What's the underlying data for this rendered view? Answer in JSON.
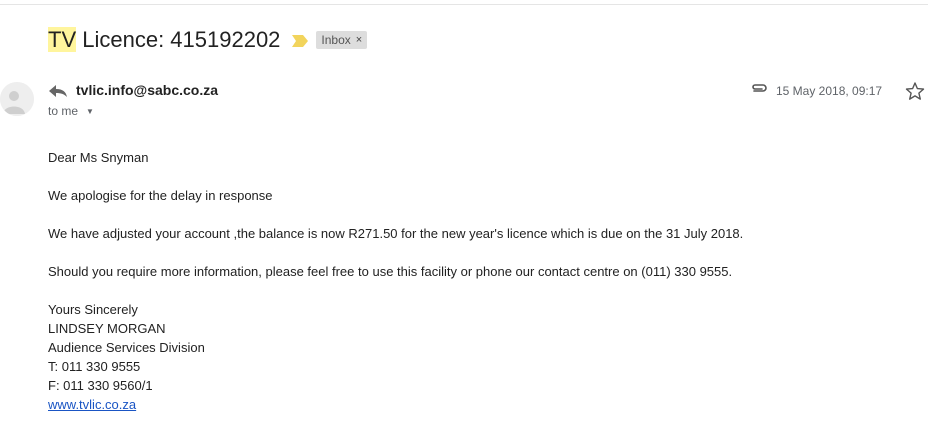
{
  "subject": {
    "highlight": "TV",
    "rest": " Licence: 415192202",
    "label": "Inbox",
    "label_close": "×"
  },
  "message": {
    "sender": "tvlic.info@sabc.co.za",
    "to_label": "to me",
    "date": "15 May 2018, 09:17"
  },
  "body": {
    "greeting": "Dear Ms Snyman",
    "line1": "We apologise for the delay in response",
    "line2": "We have adjusted your account ,the balance is now R271.50  for the new year's licence which is due on the 31 July 2018.",
    "line3": "Should you require more information, please feel free to use this facility or phone our contact centre on (011) 330 9555.",
    "signature": {
      "closing": "Yours Sincerely",
      "name": "LINDSEY MORGAN",
      "division": "Audience Services Division",
      "phone": "T: 011 330 9555",
      "fax": "F: 011 330 9560/1",
      "website": "www.tvlic.co.za"
    }
  },
  "icons": {
    "importance": "importance-marker-icon",
    "reply": "reply-icon",
    "attachment": "attachment-icon",
    "star": "star-icon",
    "avatar": "avatar-icon"
  },
  "colors": {
    "highlight": "#fff59d",
    "importance": "#f2d45c",
    "link": "#1a55c4"
  }
}
